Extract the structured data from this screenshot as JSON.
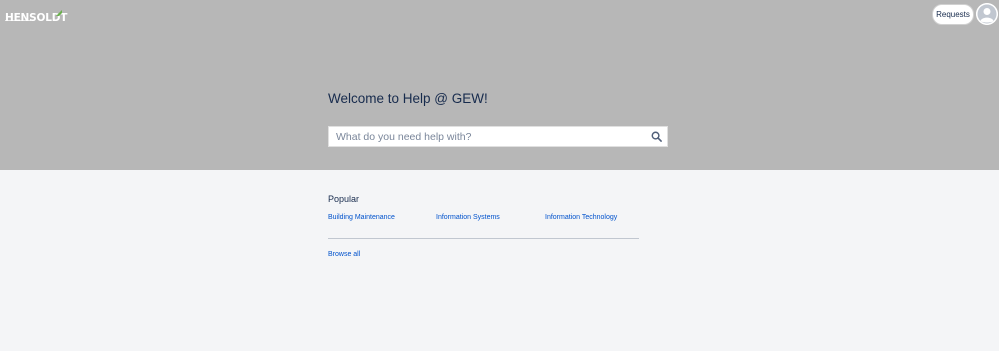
{
  "header": {
    "logo_text": "HENSOLDT",
    "requests_label": "Requests"
  },
  "hero": {
    "title": "Welcome to Help @ GEW!",
    "search_placeholder": "What do you need help with?"
  },
  "popular": {
    "heading": "Popular",
    "links": [
      {
        "label": "Building Maintenance"
      },
      {
        "label": "Information Systems"
      },
      {
        "label": "Information Technology"
      }
    ],
    "browse_all_label": "Browse all"
  },
  "colors": {
    "hero_bg": "#b7b7b7",
    "page_bg": "#f4f5f7",
    "link": "#0052cc",
    "text": "#172b4d",
    "logo_accent": "#6ab04c"
  },
  "icons": {
    "search": "search-icon",
    "avatar": "user-avatar-icon"
  }
}
